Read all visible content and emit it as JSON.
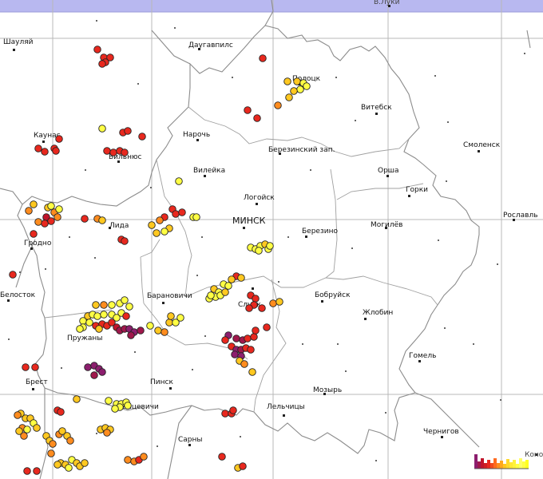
{
  "colors": {
    "sea_band": "#b8b8f0",
    "grid": "#b9b9b9",
    "border": "#8c8c8c",
    "strike_palette": [
      "#ffff44",
      "#ffc820",
      "#ff8c1e",
      "#e8281e",
      "#c0142a",
      "#a0184c",
      "#8c1e6e"
    ]
  },
  "cities": [
    {
      "name": "Шауляй"
    },
    {
      "name": "Даугавпилс"
    },
    {
      "name": "Великие Луки",
      "text": "В.Луки"
    },
    {
      "name": "Полоцк"
    },
    {
      "name": "Витебск"
    },
    {
      "name": "Каунас"
    },
    {
      "name": "Вильнюс"
    },
    {
      "name": "Нарочь"
    },
    {
      "name": "Березинский зап."
    },
    {
      "name": "Смоленск"
    },
    {
      "name": "Вилейка"
    },
    {
      "name": "Орша"
    },
    {
      "name": "Логойск"
    },
    {
      "name": "Горки"
    },
    {
      "name": "МИНСК"
    },
    {
      "name": "Могилёв"
    },
    {
      "name": "Рославль"
    },
    {
      "name": "Лида"
    },
    {
      "name": "Березино"
    },
    {
      "name": "Гродно"
    },
    {
      "name": "Барановичи"
    },
    {
      "name": "Бобруйск"
    },
    {
      "name": "Белосток"
    },
    {
      "name": "Слуцк"
    },
    {
      "name": "Жлобин"
    },
    {
      "name": "Пружаны"
    },
    {
      "name": "Гомель"
    },
    {
      "name": "Брест"
    },
    {
      "name": "Пинск"
    },
    {
      "name": "Мозырь"
    },
    {
      "name": "Пинск-Лунинец",
      "text": "Ганцевичи"
    },
    {
      "name": "Лельчицы"
    },
    {
      "name": "Сарны"
    },
    {
      "name": "Чернигов"
    },
    {
      "name": "Конотоп",
      "text": "Коно"
    }
  ],
  "legend": {
    "label": "strike-age color scale"
  }
}
